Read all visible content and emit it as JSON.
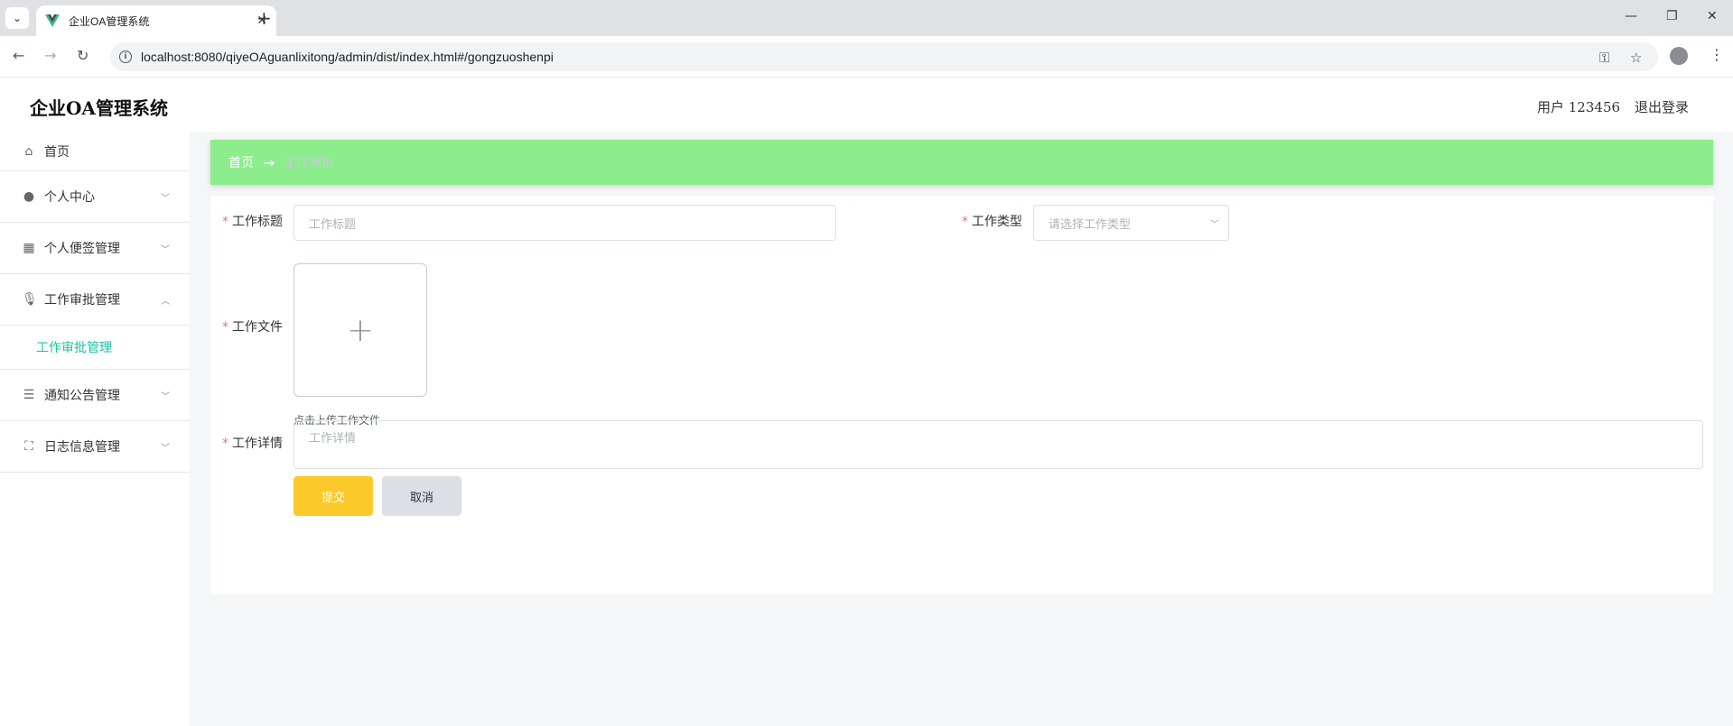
{
  "browser": {
    "tab_title": "企业OA管理系统",
    "url": "localhost:8080/qiyeOAguanlixitong/admin/dist/index.html#/gongzuoshenpi"
  },
  "header": {
    "app_title": "企业OA管理系统",
    "user_label": "用户 123456",
    "logout_label": "退出登录"
  },
  "sidebar": {
    "items": [
      {
        "label": "首页",
        "icon": "home-icon"
      },
      {
        "label": "个人中心",
        "icon": "user-icon"
      },
      {
        "label": "个人便签管理",
        "icon": "grid-icon"
      },
      {
        "label": "工作审批管理",
        "icon": "microphone-icon",
        "expanded": true
      },
      {
        "label": "通知公告管理",
        "icon": "list-icon"
      },
      {
        "label": "日志信息管理",
        "icon": "fullscreen-icon"
      }
    ],
    "active_submenu": "工作审批管理"
  },
  "breadcrumb": {
    "home": "首页",
    "arrow": "→",
    "current": "工作审批"
  },
  "form": {
    "title_label": "工作标题",
    "title_placeholder": "工作标题",
    "type_label": "工作类型",
    "type_placeholder": "请选择工作类型",
    "file_label": "工作文件",
    "upload_tip": "点击上传工作文件",
    "detail_label": "工作详情",
    "detail_placeholder": "工作详情",
    "submit_label": "提交",
    "cancel_label": "取消"
  },
  "colors": {
    "breadcrumb_bg": "#8ced8d",
    "accent": "#19c3a4",
    "submit_bg": "#fbc92a",
    "required": "#f56c6c"
  }
}
